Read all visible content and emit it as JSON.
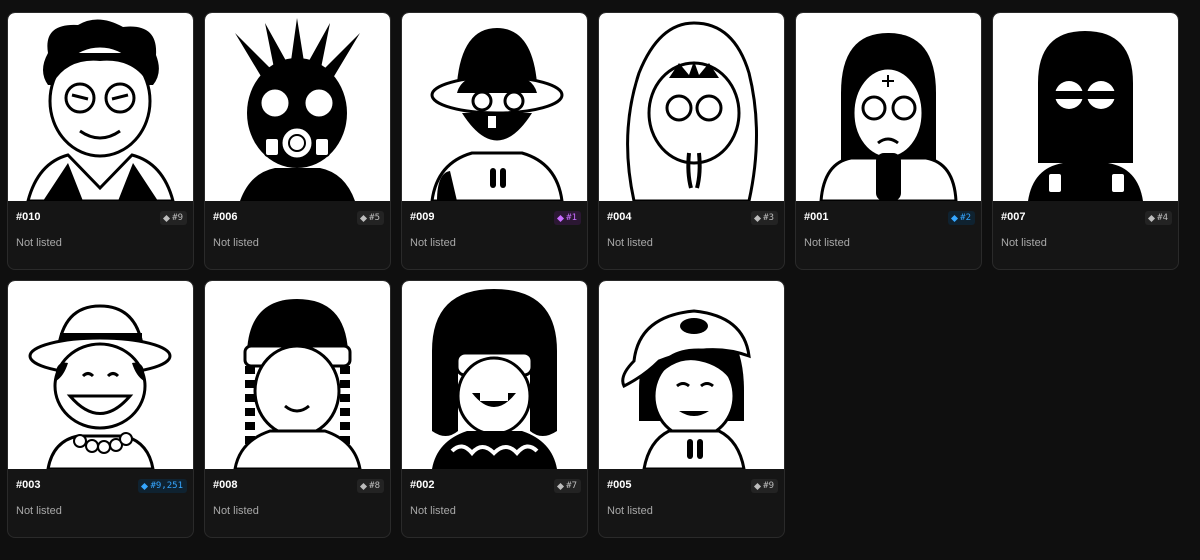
{
  "colors": {
    "background": "#0f0f0f",
    "card": "#151515",
    "rank_default": "#bdbdbd",
    "rank_purple": "#c86dff",
    "rank_blue": "#35a6ff"
  },
  "cards": [
    {
      "name": "#010",
      "rank": "#9",
      "status": "Not listed",
      "rank_color": "default",
      "icon": "avatar-curly-hair-icon"
    },
    {
      "name": "#006",
      "rank": "#5",
      "status": "Not listed",
      "rank_color": "default",
      "icon": "avatar-gas-mask-icon"
    },
    {
      "name": "#009",
      "rank": "#1",
      "status": "Not listed",
      "rank_color": "purple",
      "icon": "avatar-bucket-hat-icon"
    },
    {
      "name": "#004",
      "rank": "#3",
      "status": "Not listed",
      "rank_color": "default",
      "icon": "avatar-hood-icon"
    },
    {
      "name": "#001",
      "rank": "#2",
      "status": "Not listed",
      "rank_color": "blue",
      "icon": "avatar-balaclava-icon"
    },
    {
      "name": "#007",
      "rank": "#4",
      "status": "Not listed",
      "rank_color": "default",
      "icon": "avatar-ski-mask-icon"
    },
    {
      "name": "#003",
      "rank": "#9,251",
      "status": "Not listed",
      "rank_color": "blue",
      "icon": "avatar-straw-hat-icon"
    },
    {
      "name": "#008",
      "rank": "#8",
      "status": "Not listed",
      "rank_color": "default",
      "icon": "avatar-beanie-icon"
    },
    {
      "name": "#002",
      "rank": "#7",
      "status": "Not listed",
      "rank_color": "default",
      "icon": "avatar-ushanka-icon"
    },
    {
      "name": "#005",
      "rank": "#9",
      "status": "Not listed",
      "rank_color": "default",
      "icon": "avatar-cap-icon"
    }
  ]
}
